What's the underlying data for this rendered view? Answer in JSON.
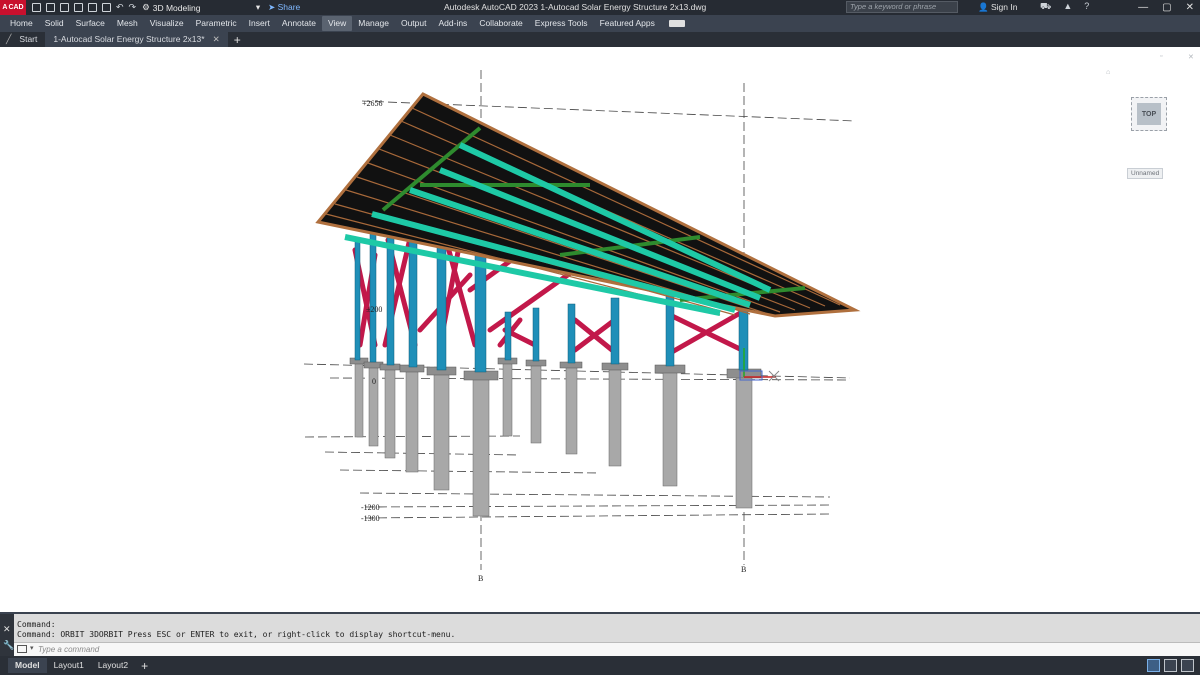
{
  "titlebar": {
    "logo_text": "CAD",
    "workspace": "3D Modeling",
    "share": "Share",
    "title": "Autodesk AutoCAD 2023   1-Autocad Solar Energy Structure 2x13.dwg",
    "search_placeholder": "Type a keyword or phrase",
    "sign_in": "Sign In"
  },
  "ribbon": {
    "tabs": [
      "Home",
      "Solid",
      "Surface",
      "Mesh",
      "Visualize",
      "Parametric",
      "Insert",
      "Annotate",
      "View",
      "Manage",
      "Output",
      "Add-ins",
      "Collaborate",
      "Express Tools",
      "Featured Apps"
    ],
    "active": "View"
  },
  "file_tabs": {
    "start": "Start",
    "active": "1-Autocad Solar Energy Structure 2x13*"
  },
  "drawing": {
    "elev_top": "+2656",
    "elev_mid": "±200",
    "elev_zero": "0",
    "elev_low1": "-1200",
    "elev_low2": "-1300",
    "grid_b1": "B",
    "grid_b2": "B"
  },
  "viewcube": {
    "face": "TOP"
  },
  "ucs": {
    "label": "Unnamed"
  },
  "command": {
    "line1": "Command:",
    "line2": "Command: ORBIT 3DORBIT Press ESC or ENTER to exit, or right-click to display shortcut-menu.",
    "placeholder": "Type a command"
  },
  "layout_tabs": [
    "Model",
    "Layout1",
    "Layout2"
  ],
  "colors": {
    "column": "#1f8fb8",
    "bracing": "#c2184a",
    "rail": "#1ec9a6",
    "purlin": "#2e8b2e",
    "panel": "#111111",
    "frame": "#b0703e",
    "pile": "#a9a9a9"
  }
}
